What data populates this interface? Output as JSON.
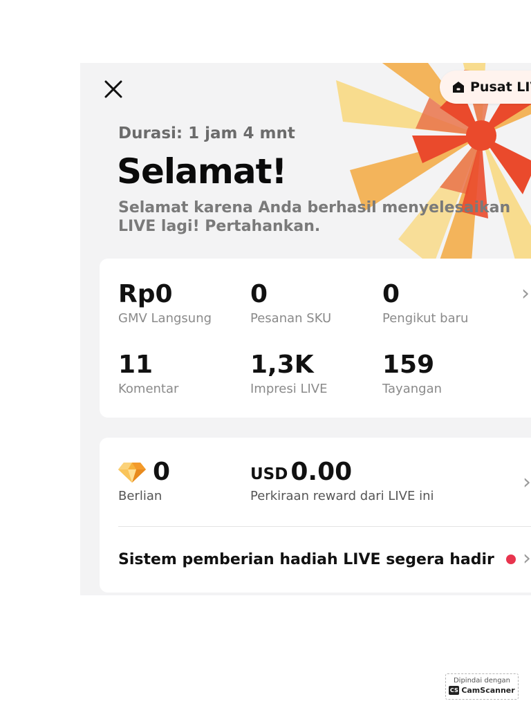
{
  "header": {
    "close_icon": "close-icon",
    "live_center_label": "Pusat LIVE",
    "live_center_icon": "home-icon"
  },
  "summary": {
    "duration": "Durasi: 1 jam 4 mnt",
    "title": "Selamat!",
    "subtitle": "Selamat karena Anda berhasil menyelesaikan LIVE lagi! Pertahankan."
  },
  "stats": [
    {
      "value": "Rp0",
      "label": "GMV Langsung"
    },
    {
      "value": "0",
      "label": "Pesanan SKU"
    },
    {
      "value": "0",
      "label": "Pengikut baru"
    },
    {
      "value": "11",
      "label": "Komentar"
    },
    {
      "value": "1,3K",
      "label": "Impresi LIVE"
    },
    {
      "value": "159",
      "label": "Tayangan"
    }
  ],
  "rewards": {
    "diamonds_value": "0",
    "diamonds_label": "Berlian",
    "diamonds_icon": "diamond-icon",
    "currency": "USD",
    "reward_value": "0.00",
    "reward_label": "Perkiraan reward dari LIVE ini",
    "notice": "Sistem pemberian hadiah LIVE segera hadir"
  },
  "chevron_glyph": "›",
  "scanner_badge": {
    "top_text": "Dipindai dengan",
    "logo_text": "CS",
    "brand": "CamScanner"
  },
  "colors": {
    "accent_red": "#e8344e",
    "burst_red": "#ea4a2c",
    "burst_orange": "#f3b45b",
    "burst_yellow": "#f8dc8e"
  }
}
